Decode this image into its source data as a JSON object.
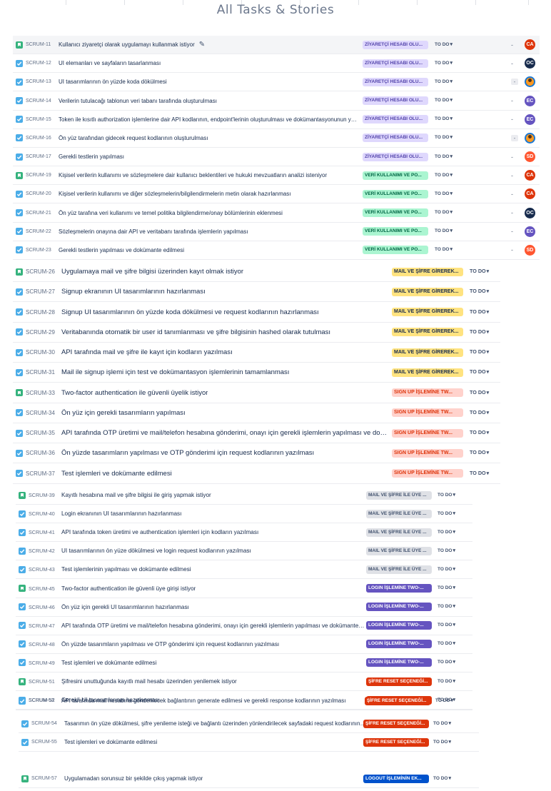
{
  "title": "All Tasks & Stories",
  "colors": {
    "epic_purple_bg": "#dfd8fd",
    "epic_purple_fg": "#5243aa",
    "epic_green_bg": "#abf5d1",
    "epic_green_fg": "#006644",
    "epic_yellow_bg": "#ffe380",
    "epic_yellow_fg": "#172b4d",
    "epic_pink_bg": "#ffd2cc",
    "epic_pink_fg": "#de350b",
    "epic_grey_bg": "#dfe1e6",
    "epic_grey_fg": "#42526e",
    "epic_violet_bg": "#6554c0",
    "epic_red_bg": "#de350b",
    "epic_blue_bg": "#0052cc",
    "avatar_ca": "#de350b",
    "avatar_oc": "#172b4d",
    "avatar_ec": "#6554c0",
    "avatar_sd": "#ff5630"
  },
  "issues": [
    {
      "type": "story",
      "key": "SCRUM-11",
      "summary": "Kullanıcı ziyaretçi olarak uygulamayı kullanmak istiyor",
      "epic": "ZİYARETÇİ HESABI OLU...",
      "status": "TO DO",
      "assignee": "CA"
    },
    {
      "type": "task",
      "key": "SCRUM-12",
      "summary": "UI elemanları ve sayfaların tasarlanması",
      "epic": "ZİYARETÇİ HESABI OLU...",
      "status": "TO DO",
      "assignee": "OC"
    },
    {
      "type": "task",
      "key": "SCRUM-13",
      "summary": "UI tasarımlarının ön yüzde koda dökülmesi",
      "epic": "ZİYARETÇİ HESABI OLU...",
      "status": "TO DO",
      "assignee": ""
    },
    {
      "type": "task",
      "key": "SCRUM-14",
      "summary": "Verilerin tutulacağı tablonun veri tabanı tarafında oluşturulması",
      "epic": "ZİYARETÇİ HESABI OLU...",
      "status": "TO DO",
      "assignee": "EC"
    },
    {
      "type": "task",
      "key": "SCRUM-15",
      "summary": "Token ile kısıtlı authorization işlemlerine dair API kodlarının, endpoint'lerinin oluşturulması ve dokümantasyonunun yapılması",
      "epic": "ZİYARETÇİ HESABI OLU...",
      "status": "TO DO",
      "assignee": "EC"
    },
    {
      "type": "task",
      "key": "SCRUM-16",
      "summary": "Ön yüz tarafından gidecek request kodlarının oluşturulması",
      "epic": "ZİYARETÇİ HESABI OLU...",
      "status": "TO DO",
      "assignee": ""
    },
    {
      "type": "task",
      "key": "SCRUM-17",
      "summary": "Gerekli testlerin yapılması",
      "epic": "ZİYARETÇİ HESABI OLU...",
      "status": "TO DO",
      "assignee": "SD"
    },
    {
      "type": "story",
      "key": "SCRUM-19",
      "summary": "Kişisel verilerin kullanımı ve sözleşmelere dair kullanıcı beklentileri ve hukuki mevzuatların analizi isteniyor",
      "epic": "VERİ KULLANIMI VE PO...",
      "status": "TO DO",
      "assignee": "CA"
    },
    {
      "type": "task",
      "key": "SCRUM-20",
      "summary": "Kişisel verilerin kullanımı ve diğer sözleşmelerin/bilgilendirmelerin metin olarak hazırlanması",
      "epic": "VERİ KULLANIMI VE PO...",
      "status": "TO DO",
      "assignee": "CA"
    },
    {
      "type": "task",
      "key": "SCRUM-21",
      "summary": "Ön yüz tarafına veri kullanımı ve temel politika bilgilendirme/onay bölümlerinin eklenmesi",
      "epic": "VERİ KULLANIMI VE PO...",
      "status": "TO DO",
      "assignee": "OC"
    },
    {
      "type": "task",
      "key": "SCRUM-22",
      "summary": "Sözleşmelerin onayına dair API ve veritabanı tarafında işlemlerin yapılması",
      "epic": "VERİ KULLANIMI VE PO...",
      "status": "TO DO",
      "assignee": "EC"
    },
    {
      "type": "task",
      "key": "SCRUM-23",
      "summary": "Gerekli testlerin yapılması ve dokümante edilmesi",
      "epic": "VERİ KULLANIMI VE PO...",
      "status": "TO DO",
      "assignee": "SD"
    },
    {
      "type": "story",
      "key": "SCRUM-26",
      "summary": "Uygulamaya mail ve şifre bilgisi üzerinden kayıt olmak istiyor",
      "epic": "MAIL VE ŞİFRE GİREREK...",
      "status": "TO DO"
    },
    {
      "type": "task",
      "key": "SCRUM-27",
      "summary": "Signup ekranının UI tasarımlarının hazırlanması",
      "epic": "MAIL VE ŞİFRE GİREREK...",
      "status": "TO DO"
    },
    {
      "type": "task",
      "key": "SCRUM-28",
      "summary": "Signup UI tasarımlarının ön yüzde koda dökülmesi ve request kodlarının hazırlanması",
      "epic": "MAIL VE ŞİFRE GİREREK...",
      "status": "TO DO"
    },
    {
      "type": "task",
      "key": "SCRUM-29",
      "summary": "Veritabanında otomatik bir user id tanımlanması ve şifre bilgisinin hashed olarak tutulması",
      "epic": "MAIL VE ŞİFRE GİREREK...",
      "status": "TO DO"
    },
    {
      "type": "task",
      "key": "SCRUM-30",
      "summary": "API tarafında mail ve şifre ile kayıt için kodların yazılması",
      "epic": "MAIL VE ŞİFRE GİREREK...",
      "status": "TO DO"
    },
    {
      "type": "task",
      "key": "SCRUM-31",
      "summary": "Mail ile signup işlemi için test ve dokümantasyon işlemlerinin tamamlanması",
      "epic": "MAIL VE ŞİFRE GİREREK...",
      "status": "TO DO"
    },
    {
      "type": "story",
      "key": "SCRUM-33",
      "summary": "Two-factor authentication ile güvenli üyelik istiyor",
      "epic": "SIGN UP İŞLEMİNE TW...",
      "status": "TO DO"
    },
    {
      "type": "task",
      "key": "SCRUM-34",
      "summary": "Ön yüz için gerekli tasarımların yapılması",
      "epic": "SIGN UP İŞLEMİNE TW...",
      "status": "TO DO"
    },
    {
      "type": "task",
      "key": "SCRUM-35",
      "summary": "API tarafında OTP üretimi ve mail/telefon hesabına gönderimi, onayı için gerekli işlemlerin yapılması ve dokümante edilmesi",
      "epic": "SIGN UP İŞLEMİNE TW...",
      "status": "TO DO"
    },
    {
      "type": "task",
      "key": "SCRUM-36",
      "summary": "Ön yüzde tasarımların yapılması ve OTP gönderimi için request kodlarının yazılması",
      "epic": "SIGN UP İŞLEMİNE TW...",
      "status": "TO DO"
    },
    {
      "type": "task",
      "key": "SCRUM-37",
      "summary": "Test işlemleri ve dokümante edilmesi",
      "epic": "SIGN UP İŞLEMİNE TW...",
      "status": "TO DO"
    },
    {
      "type": "story",
      "key": "SCRUM-39",
      "summary": "Kayıtlı hesabına mail ve şifre bilgisi ile giriş yapmak istiyor",
      "epic": "MAIL VE ŞİFRE İLE ÜYE ...",
      "status": "TO DO"
    },
    {
      "type": "task",
      "key": "SCRUM-40",
      "summary": "Login ekranının UI tasarımlarının hazırlanması",
      "epic": "MAIL VE ŞİFRE İLE ÜYE ...",
      "status": "TO DO"
    },
    {
      "type": "task",
      "key": "SCRUM-41",
      "summary": "API tarafında token üretimi ve authentication işlemleri için kodların yazılması",
      "epic": "MAIL VE ŞİFRE İLE ÜYE ...",
      "status": "TO DO"
    },
    {
      "type": "task",
      "key": "SCRUM-42",
      "summary": "UI tasarımlarının ön yüze dökülmesi ve login request kodlarının yazılması",
      "epic": "MAIL VE ŞİFRE İLE ÜYE ...",
      "status": "TO DO"
    },
    {
      "type": "task",
      "key": "SCRUM-43",
      "summary": "Test işlemlerinin yapılması ve dokümante edilmesi",
      "epic": "MAIL VE ŞİFRE İLE ÜYE ...",
      "status": "TO DO"
    },
    {
      "type": "story",
      "key": "SCRUM-45",
      "summary": "Two-factor authentication ile güvenli üye girişi istiyor",
      "epic": "LOGIN İŞLEMİNE TWO-...",
      "status": "TO DO"
    },
    {
      "type": "task",
      "key": "SCRUM-46",
      "summary": "Ön yüz için gerekli UI tasarımlarının hazırlanması",
      "epic": "LOGIN İŞLEMİNE TWO-...",
      "status": "TO DO"
    },
    {
      "type": "task",
      "key": "SCRUM-47",
      "summary": "API tarafında OTP üretimi ve mail/telefon hesabına gönderimi, onayı için gerekli işlemlerin yapılması ve dokümante edilmesi",
      "epic": "LOGIN İŞLEMİNE TWO-...",
      "status": "TO DO"
    },
    {
      "type": "task",
      "key": "SCRUM-48",
      "summary": "Ön yüzde tasarımların yapılması ve OTP gönderimi için request kodlarının yazılması",
      "epic": "LOGIN İŞLEMİNE TWO-...",
      "status": "TO DO"
    },
    {
      "type": "task",
      "key": "SCRUM-49",
      "summary": "Test işlemleri ve dokümante edilmesi",
      "epic": "LOGIN İŞLEMİNE TWO-...",
      "status": "TO DO"
    },
    {
      "type": "story",
      "key": "SCRUM-51",
      "summary": "Şifresini unuttuğunda kayıtlı mail hesabı üzerinden yenilemek istiyor",
      "epic": "ŞİFRE RESET SEÇENEĞİ...",
      "status": "TO DO"
    },
    {
      "type": "task",
      "key": "SCRUM-52",
      "summary": "Gerekli UI tasarımlarının hazırlanması",
      "epic": "ŞİFRE RESET SEÇENEĞİ...",
      "status": "TO DO"
    },
    {
      "type": "task",
      "key": "SCRUM-53",
      "summary": "API tarafında mail hesabına gönderilecek bağlantının generate edilmesi ve gerekli response kodlarının yazılması",
      "epic": "ŞİFRE RESET SEÇENEĞİ...",
      "status": "TO DO"
    },
    {
      "type": "task",
      "key": "SCRUM-54",
      "summary": "Tasarımın ön yüze dökülmesi, şifre yenileme isteği ve bağlantı üzerinden yönlendirilecek sayfadaki request kodlarının yazılması",
      "epic": "ŞİFRE RESET SEÇENEĞİ...",
      "status": "TO DO"
    },
    {
      "type": "task",
      "key": "SCRUM-55",
      "summary": "Test işlemleri ve dokümante edilmesi",
      "epic": "ŞİFRE RESET SEÇENEĞİ...",
      "status": "TO DO"
    },
    {
      "type": "story",
      "key": "SCRUM-57",
      "summary": "Uygulamadan sorunsuz bir şekilde çıkış yapmak istiyor",
      "epic": "LOGOUT İŞLEMİNİN EK...",
      "status": "TO DO"
    }
  ]
}
